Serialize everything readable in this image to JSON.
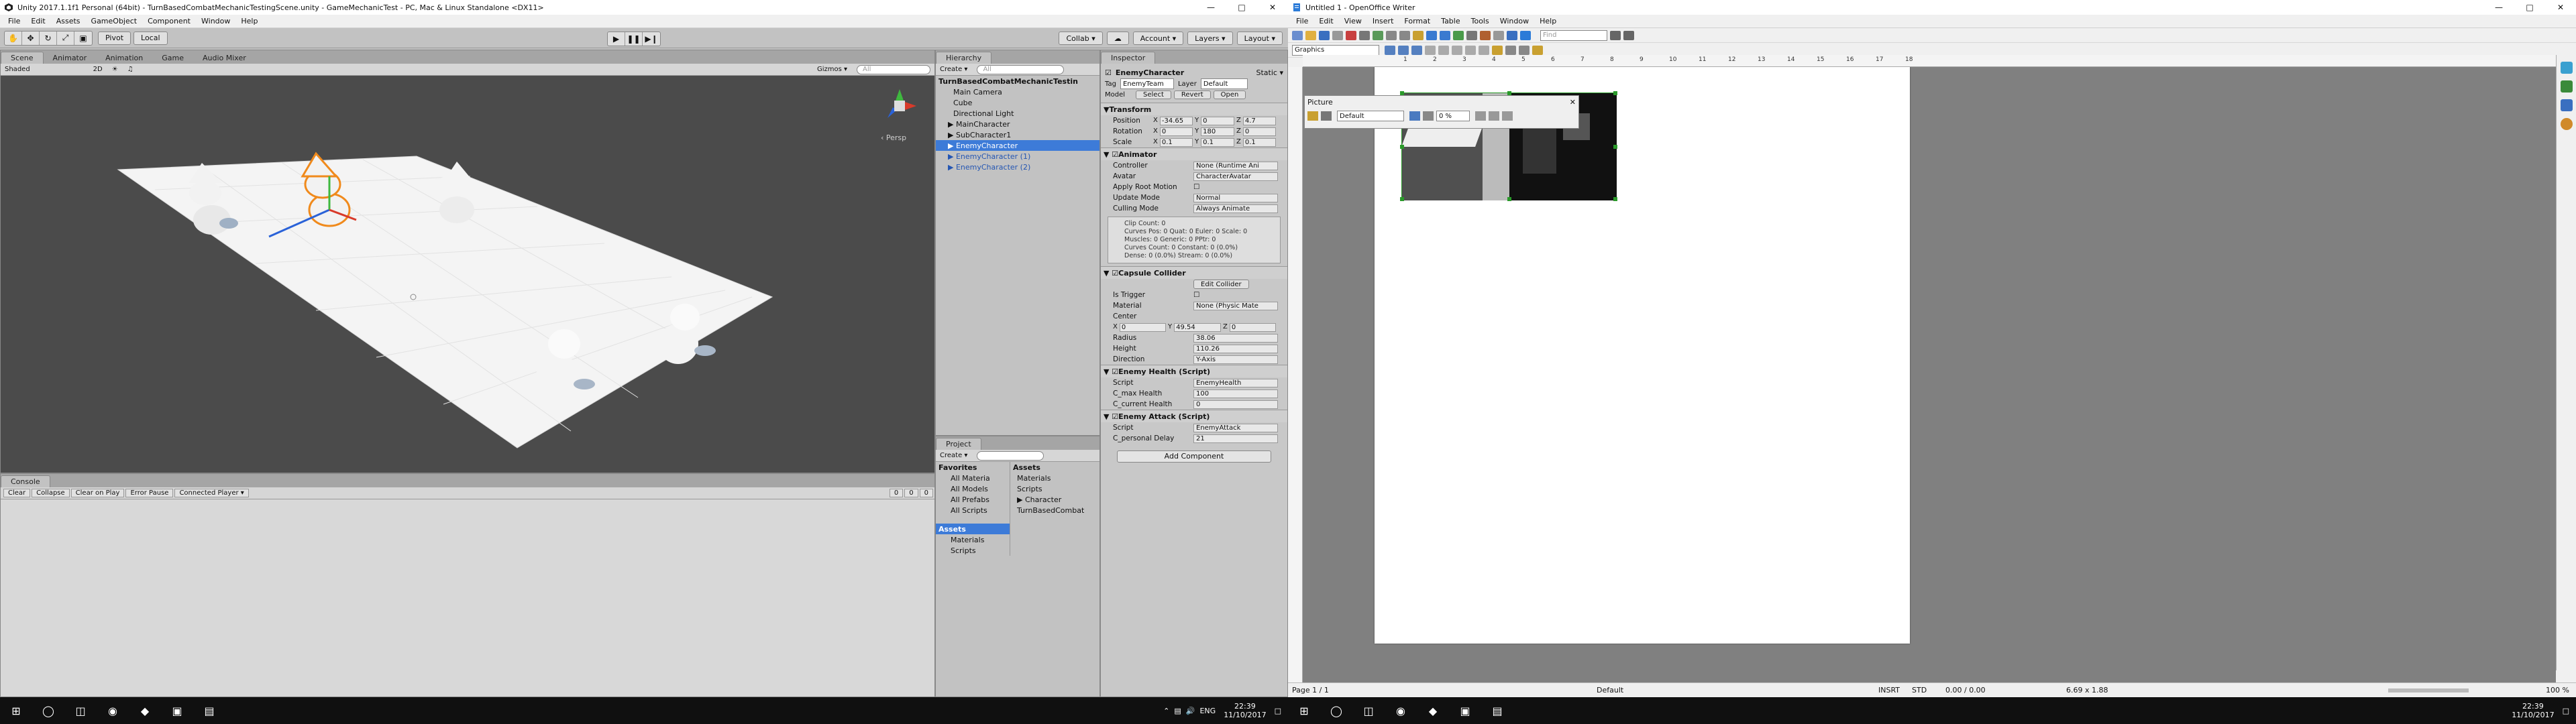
{
  "unity": {
    "title": "Unity 2017.1.1f1 Personal (64bit) - TurnBasedCombatMechanicTestingScene.unity - GameMechanicTest - PC, Mac & Linux Standalone <DX11>",
    "menu": [
      "File",
      "Edit",
      "Assets",
      "GameObject",
      "Component",
      "Window",
      "Help"
    ],
    "toolbar": {
      "pivot": "Pivot",
      "local": "Local",
      "collab": "Collab ▾",
      "cloud": "☁",
      "account": "Account ▾",
      "layers": "Layers ▾",
      "layout": "Layout ▾"
    },
    "scene": {
      "tabs": [
        "Scene",
        "Animator",
        "Animation",
        "Game",
        "Audio Mixer"
      ],
      "shading": "Shaded",
      "mode_2d": "2D",
      "gizmos": "Gizmos ▾",
      "search": "All",
      "persp": "‹ Persp"
    },
    "hierarchy": {
      "tab": "Hierarchy",
      "create": "Create ▾",
      "search": "All",
      "scene_root": "TurnBasedCombatMechanicTestin",
      "items": [
        "Main Camera",
        "Cube",
        "Directional Light",
        "▶ MainCharacter",
        "▶ SubCharacter1",
        "▶ EnemyCharacter",
        "▶ EnemyCharacter (1)",
        "▶ EnemyCharacter (2)"
      ]
    },
    "inspector": {
      "tab": "Inspector",
      "object_name": "EnemyCharacter",
      "static": "Static ▾",
      "tag_label": "Tag",
      "tag": "EnemyTeam",
      "layer_label": "Layer",
      "layer": "Default",
      "model_label": "Model",
      "model_select": "Select",
      "model_revert": "Revert",
      "model_open": "Open",
      "transform": {
        "title": "Transform",
        "position": [
          "-34.65",
          "0",
          "4.7"
        ],
        "rotation": [
          "0",
          "180",
          "0"
        ],
        "scale": [
          "0.1",
          "0.1",
          "0.1"
        ],
        "labels": [
          "Position",
          "Rotation",
          "Scale"
        ]
      },
      "animator": {
        "title": "Animator",
        "controller_label": "Controller",
        "controller": "None (Runtime Ani",
        "avatar_label": "Avatar",
        "avatar": "CharacterAvatar",
        "apply_root_label": "Apply Root Motion",
        "update_label": "Update Mode",
        "update": "Normal",
        "culling_label": "Culling Mode",
        "culling": "Always Animate",
        "info": [
          "Clip Count: 0",
          "Curves Pos: 0 Quat: 0 Euler: 0 Scale: 0",
          "Muscles: 0 Generic: 0 PPtr: 0",
          "Curves Count: 0 Constant: 0 (0.0%)",
          "Dense: 0 (0.0%) Stream: 0 (0.0%)"
        ]
      },
      "capsule": {
        "title": "Capsule Collider",
        "edit": "Edit Collider",
        "trigger_label": "Is Trigger",
        "material_label": "Material",
        "material": "None (Physic Mate",
        "center_label": "Center",
        "center": [
          "0",
          "49.54",
          "0"
        ],
        "radius_label": "Radius",
        "radius": "38.06",
        "height_label": "Height",
        "height": "110.26",
        "direction_label": "Direction",
        "direction": "Y-Axis"
      },
      "health": {
        "title": "Enemy Health (Script)",
        "script_label": "Script",
        "script": "EnemyHealth",
        "max_label": "C_max Health",
        "max": "100",
        "current_label": "C_current Health",
        "current": "0"
      },
      "attack": {
        "title": "Enemy Attack (Script)",
        "script_label": "Script",
        "script": "EnemyAttack",
        "delay_label": "C_personal Delay",
        "delay": "21"
      },
      "add_component": "Add Component"
    },
    "project": {
      "tab": "Project",
      "create": "Create ▾",
      "favorites": "Favorites",
      "fav_items": [
        "All Materia",
        "All Models",
        "All Prefabs",
        "All Scripts"
      ],
      "assets_root": "Assets",
      "tree_items": [
        "Materials",
        "Scripts"
      ],
      "breadcrumb": "Assets",
      "asset_items": [
        "Materials",
        "Scripts",
        "▶ Character",
        "TurnBasedCombat"
      ]
    },
    "console": {
      "tab": "Console",
      "buttons": [
        "Clear",
        "Collapse",
        "Clear on Play",
        "Error Pause",
        "Connected Player ▾"
      ],
      "counts": [
        "0",
        "0",
        "0"
      ]
    }
  },
  "writer": {
    "title": "Untitled 1 - OpenOffice Writer",
    "menu": [
      "File",
      "Edit",
      "View",
      "Insert",
      "Format",
      "Table",
      "Tools",
      "Window",
      "Help"
    ],
    "find_placeholder": "Find",
    "frame_style": "Graphics",
    "picture_toolbar": {
      "title": "Picture",
      "mode": "Default",
      "transparency": "0 %"
    },
    "ruler_numbers": [
      "1",
      "2",
      "3",
      "4",
      "5",
      "6",
      "7",
      "8",
      "9",
      "10",
      "11",
      "12",
      "13",
      "14",
      "15",
      "16",
      "17",
      "18"
    ],
    "status": {
      "page": "Page 1 / 1",
      "style": "Default",
      "insert": "INSRT",
      "std": "STD",
      "pos": "0.00 / 0.00",
      "size": "6.69 x 1.88",
      "zoom": "100 %"
    }
  },
  "taskbar_left": {
    "time": "22:39",
    "date": "11/10/2017",
    "lang": "ENG"
  },
  "taskbar_right": {
    "time": "22:39",
    "date": "11/10/2017"
  },
  "colors": {
    "selection": "#3d7bd8",
    "unity_bg": "#c2c2c2",
    "scene_bg": "#4b4b4b",
    "writer_bg": "#808080"
  }
}
